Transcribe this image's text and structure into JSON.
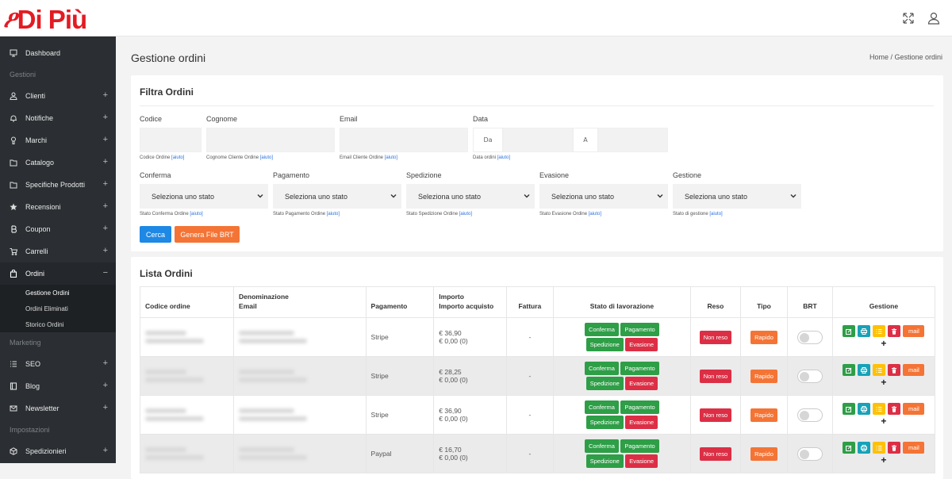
{
  "brand": {
    "logo_text": "Di Più",
    "color": "#e31b23"
  },
  "topbar": {
    "icons": [
      "fullscreen-icon",
      "user-icon"
    ]
  },
  "sidebar": {
    "items": [
      {
        "label": "Dashboard",
        "icon": "monitor-icon"
      },
      {
        "section": "Gestioni"
      },
      {
        "label": "Clienti",
        "icon": "user-icon",
        "plus": "+"
      },
      {
        "label": "Notifiche",
        "icon": "bell-icon",
        "plus": "+"
      },
      {
        "label": "Marchi",
        "icon": "brand-icon",
        "plus": "+"
      },
      {
        "label": "Catalogo",
        "icon": "folder-icon",
        "plus": "+"
      },
      {
        "label": "Specifiche Prodotti",
        "icon": "folder-icon",
        "plus": "+"
      },
      {
        "label": "Recensioni",
        "icon": "star-icon",
        "plus": "+"
      },
      {
        "label": "Coupon",
        "icon": "coupon-icon",
        "plus": "+"
      },
      {
        "label": "Carrelli",
        "icon": "cart-icon",
        "plus": "+"
      },
      {
        "label": "Ordini",
        "icon": "bag-icon",
        "plus": "−"
      }
    ],
    "ordini_sub": [
      "Gestione Ordini",
      "Ordini Eliminati",
      "Storico Ordini"
    ],
    "marketing": "Marketing",
    "seo": "SEO",
    "blog": "Blog",
    "newsletter": "Newsletter",
    "impostazioni": "Impostazioni",
    "spedizionieri": "Spedizionieri",
    "plus": "+"
  },
  "page": {
    "title": "Gestione ordini",
    "breadcrumb": "Home  /  Gestione ordini"
  },
  "filter": {
    "title": "Filtra Ordini",
    "codice": {
      "label": "Codice",
      "help": "Codice Ordine",
      "aiuto": "[aiuto]"
    },
    "cognome": {
      "label": "Cognome",
      "help": "Cognome Cliente Ordine",
      "aiuto": "[aiuto]"
    },
    "email": {
      "label": "Email",
      "help": "Email Cliente Ordine",
      "aiuto": "[aiuto]"
    },
    "data": {
      "label": "Data",
      "da": "Da",
      "a": "A",
      "help": "Data ordini",
      "aiuto": "[aiuto]"
    },
    "conferma": {
      "label": "Conferma",
      "value": "Seleziona uno stato",
      "help": "Stato Conferma Ordine",
      "aiuto": "[aiuto]"
    },
    "pagamento": {
      "label": "Pagamento",
      "value": "Seleziona uno stato",
      "help": "Stato Pagamento Ordine",
      "aiuto": "[aiuto]"
    },
    "spedizione": {
      "label": "Spedizione",
      "value": "Seleziona uno stato",
      "help": "Stato Spedizione Ordine",
      "aiuto": "[aiuto]"
    },
    "evasione": {
      "label": "Evasione",
      "value": "Seleziona uno stato",
      "help": "Stato Evasione Ordine",
      "aiuto": "[aiuto]"
    },
    "gestione": {
      "label": "Gestione",
      "value": "Seleziona uno stato",
      "help": "Stato di gestione",
      "aiuto": "[aiuto]"
    },
    "cerca": "Cerca",
    "genera": "Genera File BRT"
  },
  "list": {
    "title": "Lista Ordini",
    "headers": {
      "codice": "Codice ordine",
      "denominazione": "Denominazione",
      "email": "Email",
      "pagamento": "Pagamento",
      "importo": "Importo",
      "importo_acquisto": "Importo acquisto",
      "fattura": "Fattura",
      "stato": "Stato di lavorazione",
      "reso": "Reso",
      "tipo": "Tipo",
      "brt": "BRT",
      "gestione": "Gestione"
    },
    "labels": {
      "conferma": "Conferma",
      "pagamento": "Pagamento",
      "spedizione": "Spedizione",
      "evasione": "Evasione",
      "non_reso": "Non reso",
      "rapido": "Rapido",
      "mail": "mail",
      "plus": "+"
    },
    "rows": [
      {
        "pagamento": "Stripe",
        "importo": "€ 36,90",
        "acquisto": "€ 0,00 (0)",
        "fattura": "-"
      },
      {
        "pagamento": "Stripe",
        "importo": "€ 28,25",
        "acquisto": "€ 0,00 (0)",
        "fattura": "-"
      },
      {
        "pagamento": "Stripe",
        "importo": "€ 36,90",
        "acquisto": "€ 0,00 (0)",
        "fattura": "-"
      },
      {
        "pagamento": "Paypal",
        "importo": "€ 16,70",
        "acquisto": "€ 0,00 (0)",
        "fattura": "-"
      }
    ]
  },
  "colors": {
    "primary": "#1e88e5",
    "orange": "#f47435",
    "green": "#2e9e47",
    "red": "#dc2f45",
    "teal": "#17a2b8",
    "yellow": "#ffc107",
    "sidebar": "#2b2f33"
  }
}
